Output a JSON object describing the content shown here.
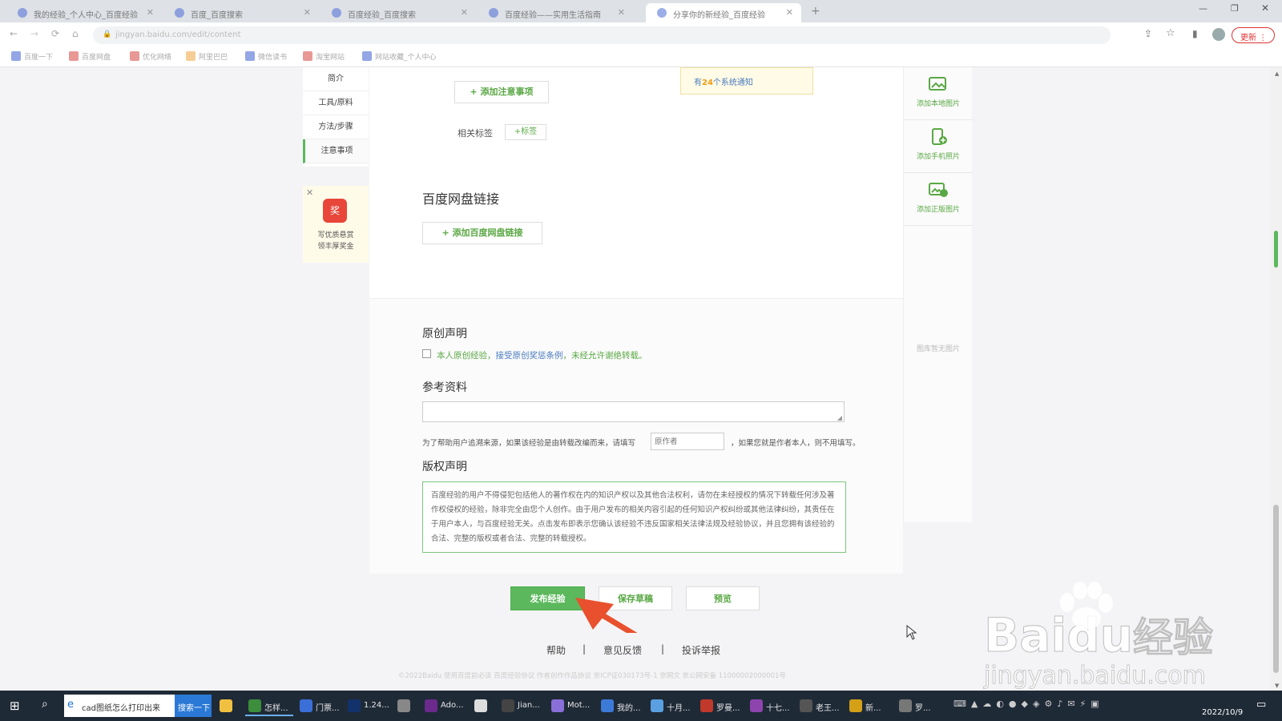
{
  "browser": {
    "tabs": [
      {
        "title": "我的经验_个人中心_百度经验",
        "active": false
      },
      {
        "title": "百度_百度搜索",
        "active": false
      },
      {
        "title": "百度经验_百度搜索",
        "active": false
      },
      {
        "title": "百度经验——实用生活指南",
        "active": false
      },
      {
        "title": "分享你的新经验_百度经验",
        "active": true
      }
    ],
    "url": "jingyan.baidu.com/edit/content",
    "update_label": "更新",
    "bookmarks": [
      "百度一下",
      "百度网盘",
      "优化网络",
      "阿里巴巴",
      "微信读书",
      "淘宝网站",
      "网站收藏_个人中心"
    ]
  },
  "leftnav": {
    "items": [
      "简介",
      "工具/原料",
      "方法/步骤",
      "注意事项"
    ],
    "active_index": 3
  },
  "promo": {
    "badge": "奖",
    "line1": "写优质悬赏",
    "line2": "领丰厚奖金"
  },
  "notice": {
    "prefix": "有",
    "count": "24",
    "suffix": "个系统通知"
  },
  "editor": {
    "add_note_label": "+ 添加注意事项",
    "tags_label": "相关标签",
    "add_tag_label": "+标签",
    "pan_section_title": "百度网盘链接",
    "add_pan_label": "+ 添加百度网盘链接",
    "original_title": "原创声明",
    "original_text_a": "本人原创经验，",
    "original_link": "接受原创奖惩条例",
    "original_text_b": "，未经允许谢绝转载。",
    "reference_title": "参考资料",
    "reference_help_a": "为了帮助用户追溯来源，如果该经验是由转载改编而来，请填写",
    "reference_author_placeholder": "原作者",
    "reference_help_b": "，如果您就是作者本人，则不用填写。",
    "copyright_title": "版权声明",
    "copyright_text": "百度经验的用户不得侵犯包括他人的著作权在内的知识产权以及其他合法权利，请勿在未经授权的情况下转载任何涉及著作权侵权的经验，除非完全由您个人创作。由于用户发布的相关内容引起的任何知识产权纠纷或其他法律纠纷，其责任在于用户本人，与百度经验无关。点击发布即表示您确认该经验不违反国家相关法律法规及经验协议，并且您拥有该经验的合法、完整的版权或者合法、完整的转载授权。"
  },
  "sidepanel": {
    "add_local": "添加本地图片",
    "add_phone": "添加手机照片",
    "add_licensed": "添加正版图片",
    "empty_text": "图库暂无图片"
  },
  "actions": {
    "publish": "发布经验",
    "save": "保存草稿",
    "preview": "预览"
  },
  "footer": {
    "links": [
      "帮助",
      "意见反馈",
      "投诉举报"
    ],
    "copyright": "©2022Baidu  使用百度前必读  百度经验协议  作者创作作品协议  京ICP证030173号-1  京网文  京公网安备 11000002000001号"
  },
  "watermark": {
    "brand": "Bai",
    "brand2": "du",
    "label": "经验",
    "url": "jingyan.baidu.com"
  },
  "taskbar": {
    "search_text": "cad图纸怎么打印出来",
    "search_button": "搜索一下",
    "apps": [
      "怎样...",
      "门票...",
      "1.24...",
      "Ado...",
      "Jian...",
      "Mot...",
      "我的...",
      "十月...",
      "罗曼...",
      "十七...",
      "老王...",
      "新...",
      "罗..."
    ],
    "date": "2022/10/9"
  },
  "colors": {
    "accent": "#5cb85c",
    "link": "#4a7bbf",
    "arrow": "#e8502e"
  }
}
